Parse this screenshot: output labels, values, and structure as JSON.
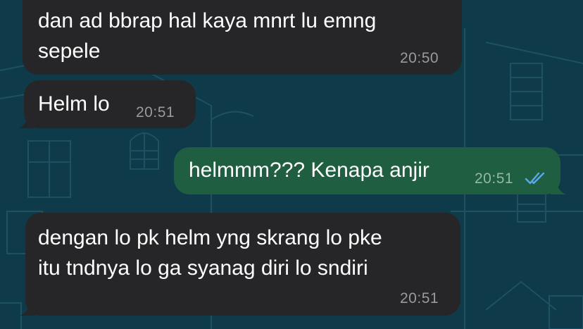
{
  "chat": {
    "messages": [
      {
        "direction": "incoming",
        "text": "dan ad bbrap hal kaya mnrt lu emng\nsepele",
        "time": "20:50"
      },
      {
        "direction": "incoming",
        "text": "Helm lo",
        "time": "20:51"
      },
      {
        "direction": "outgoing",
        "text": "helmmm??? Kenapa anjir",
        "time": "20:51",
        "status_icon": "double-check-read-icon"
      },
      {
        "direction": "incoming",
        "text": "dengan lo pk helm yng skrang lo pke\nitu tndnya lo ga syanag diri lo sndiri",
        "time": "20:51"
      }
    ]
  },
  "colors": {
    "wallpaper": "#0e3a4a",
    "incoming_bubble": "#262628",
    "outgoing_bubble": "#1f5e40",
    "read_check": "#5aa9e6"
  }
}
